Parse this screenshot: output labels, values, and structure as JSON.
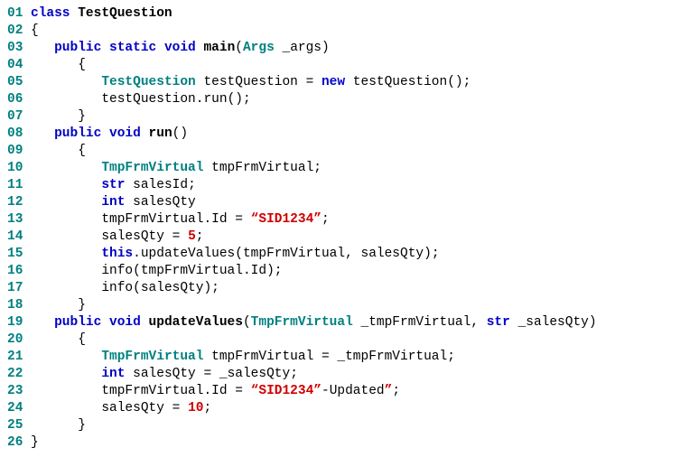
{
  "code": {
    "lines": [
      {
        "no": "01",
        "indent": 0,
        "tokens": [
          {
            "t": "kw-blue",
            "v": "class"
          },
          {
            "t": "sp",
            "v": " "
          },
          {
            "t": "fn",
            "v": "TestQuestion"
          }
        ]
      },
      {
        "no": "02",
        "indent": 0,
        "tokens": [
          {
            "t": "punct",
            "v": "{"
          }
        ]
      },
      {
        "no": "03",
        "indent": 1,
        "tokens": [
          {
            "t": "kw-blue",
            "v": "public"
          },
          {
            "t": "sp",
            "v": " "
          },
          {
            "t": "kw-blue",
            "v": "static"
          },
          {
            "t": "sp",
            "v": " "
          },
          {
            "t": "kw-blue",
            "v": "void"
          },
          {
            "t": "sp",
            "v": " "
          },
          {
            "t": "fn",
            "v": "main"
          },
          {
            "t": "punct",
            "v": "("
          },
          {
            "t": "kw-teal",
            "v": "Args"
          },
          {
            "t": "sp",
            "v": " "
          },
          {
            "t": "plain",
            "v": "_args"
          },
          {
            "t": "punct",
            "v": ")"
          }
        ]
      },
      {
        "no": "04",
        "indent": 2,
        "tokens": [
          {
            "t": "punct",
            "v": "{"
          }
        ]
      },
      {
        "no": "05",
        "indent": 3,
        "tokens": [
          {
            "t": "kw-teal",
            "v": "TestQuestion"
          },
          {
            "t": "sp",
            "v": " "
          },
          {
            "t": "plain",
            "v": "testQuestion"
          },
          {
            "t": "sp",
            "v": " "
          },
          {
            "t": "punct",
            "v": "="
          },
          {
            "t": "sp",
            "v": " "
          },
          {
            "t": "kw-blue",
            "v": "new"
          },
          {
            "t": "sp",
            "v": " "
          },
          {
            "t": "plain",
            "v": "testQuestion"
          },
          {
            "t": "punct",
            "v": "();"
          }
        ]
      },
      {
        "no": "06",
        "indent": 3,
        "tokens": [
          {
            "t": "plain",
            "v": "testQuestion"
          },
          {
            "t": "punct",
            "v": "."
          },
          {
            "t": "plain",
            "v": "run"
          },
          {
            "t": "punct",
            "v": "();"
          }
        ]
      },
      {
        "no": "07",
        "indent": 2,
        "tokens": [
          {
            "t": "punct",
            "v": "}"
          }
        ]
      },
      {
        "no": "08",
        "indent": 1,
        "tokens": [
          {
            "t": "kw-blue",
            "v": "public"
          },
          {
            "t": "sp",
            "v": " "
          },
          {
            "t": "kw-blue",
            "v": "void"
          },
          {
            "t": "sp",
            "v": " "
          },
          {
            "t": "fn",
            "v": "run"
          },
          {
            "t": "punct",
            "v": "()"
          }
        ]
      },
      {
        "no": "09",
        "indent": 2,
        "tokens": [
          {
            "t": "punct",
            "v": "{"
          }
        ]
      },
      {
        "no": "10",
        "indent": 3,
        "tokens": [
          {
            "t": "kw-teal",
            "v": "TmpFrmVirtual"
          },
          {
            "t": "sp",
            "v": " "
          },
          {
            "t": "plain",
            "v": "tmpFrmVirtual"
          },
          {
            "t": "punct",
            "v": ";"
          }
        ]
      },
      {
        "no": "11",
        "indent": 3,
        "tokens": [
          {
            "t": "kw-blue",
            "v": "str"
          },
          {
            "t": "sp",
            "v": " "
          },
          {
            "t": "plain",
            "v": "salesId"
          },
          {
            "t": "punct",
            "v": ";"
          }
        ]
      },
      {
        "no": "12",
        "indent": 3,
        "tokens": [
          {
            "t": "kw-blue",
            "v": "int"
          },
          {
            "t": "sp",
            "v": " "
          },
          {
            "t": "plain",
            "v": "salesQty"
          }
        ]
      },
      {
        "no": "13",
        "indent": 3,
        "tokens": [
          {
            "t": "plain",
            "v": "tmpFrmVirtual"
          },
          {
            "t": "punct",
            "v": "."
          },
          {
            "t": "plain",
            "v": "Id"
          },
          {
            "t": "sp",
            "v": " "
          },
          {
            "t": "punct",
            "v": "="
          },
          {
            "t": "sp",
            "v": " "
          },
          {
            "t": "str",
            "v": "“SID1234”"
          },
          {
            "t": "punct",
            "v": ";"
          }
        ]
      },
      {
        "no": "14",
        "indent": 3,
        "tokens": [
          {
            "t": "plain",
            "v": "salesQty"
          },
          {
            "t": "sp",
            "v": " "
          },
          {
            "t": "punct",
            "v": "="
          },
          {
            "t": "sp",
            "v": " "
          },
          {
            "t": "num",
            "v": "5"
          },
          {
            "t": "punct",
            "v": ";"
          }
        ]
      },
      {
        "no": "15",
        "indent": 3,
        "tokens": [
          {
            "t": "kw-blue",
            "v": "this"
          },
          {
            "t": "punct",
            "v": "."
          },
          {
            "t": "plain",
            "v": "updateValues"
          },
          {
            "t": "punct",
            "v": "("
          },
          {
            "t": "plain",
            "v": "tmpFrmVirtual"
          },
          {
            "t": "punct",
            "v": ","
          },
          {
            "t": "sp",
            "v": " "
          },
          {
            "t": "plain",
            "v": "salesQty"
          },
          {
            "t": "punct",
            "v": ");"
          }
        ]
      },
      {
        "no": "16",
        "indent": 3,
        "tokens": [
          {
            "t": "plain",
            "v": "info"
          },
          {
            "t": "punct",
            "v": "("
          },
          {
            "t": "plain",
            "v": "tmpFrmVirtual"
          },
          {
            "t": "punct",
            "v": "."
          },
          {
            "t": "plain",
            "v": "Id"
          },
          {
            "t": "punct",
            "v": ");"
          }
        ]
      },
      {
        "no": "17",
        "indent": 3,
        "tokens": [
          {
            "t": "plain",
            "v": "info"
          },
          {
            "t": "punct",
            "v": "("
          },
          {
            "t": "plain",
            "v": "salesQty"
          },
          {
            "t": "punct",
            "v": ");"
          }
        ]
      },
      {
        "no": "18",
        "indent": 2,
        "tokens": [
          {
            "t": "punct",
            "v": "}"
          }
        ]
      },
      {
        "no": "19",
        "indent": 1,
        "tokens": [
          {
            "t": "kw-blue",
            "v": "public"
          },
          {
            "t": "sp",
            "v": " "
          },
          {
            "t": "kw-blue",
            "v": "void"
          },
          {
            "t": "sp",
            "v": " "
          },
          {
            "t": "fn",
            "v": "updateValues"
          },
          {
            "t": "punct",
            "v": "("
          },
          {
            "t": "kw-teal",
            "v": "TmpFrmVirtual"
          },
          {
            "t": "sp",
            "v": " "
          },
          {
            "t": "plain",
            "v": "_tmpFrmVirtual"
          },
          {
            "t": "punct",
            "v": ","
          },
          {
            "t": "sp",
            "v": " "
          },
          {
            "t": "kw-blue",
            "v": "str"
          },
          {
            "t": "sp",
            "v": " "
          },
          {
            "t": "plain",
            "v": "_salesQty"
          },
          {
            "t": "punct",
            "v": ")"
          }
        ]
      },
      {
        "no": "20",
        "indent": 2,
        "tokens": [
          {
            "t": "punct",
            "v": "{"
          }
        ]
      },
      {
        "no": "21",
        "indent": 3,
        "tokens": [
          {
            "t": "kw-teal",
            "v": "TmpFrmVirtual"
          },
          {
            "t": "sp",
            "v": " "
          },
          {
            "t": "plain",
            "v": "tmpFrmVirtual"
          },
          {
            "t": "sp",
            "v": " "
          },
          {
            "t": "punct",
            "v": "="
          },
          {
            "t": "sp",
            "v": " "
          },
          {
            "t": "plain",
            "v": "_tmpFrmVirtual"
          },
          {
            "t": "punct",
            "v": ";"
          }
        ]
      },
      {
        "no": "22",
        "indent": 3,
        "tokens": [
          {
            "t": "kw-blue",
            "v": "int"
          },
          {
            "t": "sp",
            "v": " "
          },
          {
            "t": "plain",
            "v": "salesQty"
          },
          {
            "t": "sp",
            "v": " "
          },
          {
            "t": "punct",
            "v": "="
          },
          {
            "t": "sp",
            "v": " "
          },
          {
            "t": "plain",
            "v": "_salesQty"
          },
          {
            "t": "punct",
            "v": ";"
          }
        ]
      },
      {
        "no": "23",
        "indent": 3,
        "tokens": [
          {
            "t": "plain",
            "v": "tmpFrmVirtual"
          },
          {
            "t": "punct",
            "v": "."
          },
          {
            "t": "plain",
            "v": "Id"
          },
          {
            "t": "sp",
            "v": " "
          },
          {
            "t": "punct",
            "v": "="
          },
          {
            "t": "sp",
            "v": " "
          },
          {
            "t": "str",
            "v": "“SID1234”"
          },
          {
            "t": "plain",
            "v": "-"
          },
          {
            "t": "plain",
            "v": "Updated"
          },
          {
            "t": "str",
            "v": "”"
          },
          {
            "t": "punct",
            "v": ";"
          }
        ]
      },
      {
        "no": "24",
        "indent": 3,
        "tokens": [
          {
            "t": "plain",
            "v": "salesQty"
          },
          {
            "t": "sp",
            "v": " "
          },
          {
            "t": "punct",
            "v": "="
          },
          {
            "t": "sp",
            "v": " "
          },
          {
            "t": "num",
            "v": "10"
          },
          {
            "t": "punct",
            "v": ";"
          }
        ]
      },
      {
        "no": "25",
        "indent": 2,
        "tokens": [
          {
            "t": "punct",
            "v": "}"
          }
        ]
      },
      {
        "no": "26",
        "indent": 0,
        "tokens": [
          {
            "t": "punct",
            "v": "}"
          }
        ]
      }
    ]
  }
}
